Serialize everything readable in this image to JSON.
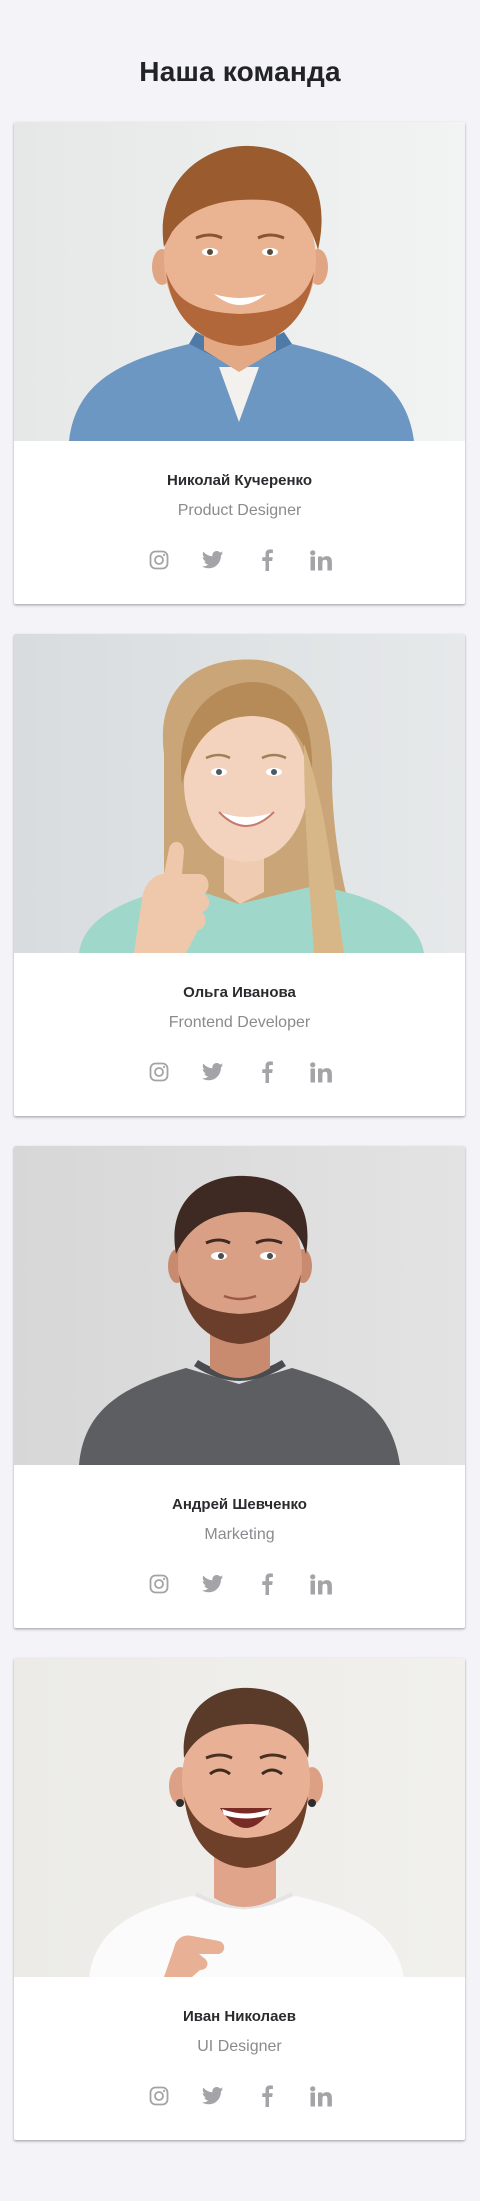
{
  "page": {
    "title": "Наша команда"
  },
  "colors": {
    "background": "#f4f3f8",
    "card": "#ffffff",
    "title": "#222327",
    "role": "#8a8a8f",
    "icon": "#a3a3a8"
  },
  "team": [
    {
      "name": "Николай Кучеренко",
      "role": "Product Designer",
      "photo": "man with light ginger hair and beard in denim shirt",
      "socials": [
        "instagram-icon",
        "twitter-icon",
        "facebook-icon",
        "linkedin-icon"
      ]
    },
    {
      "name": "Ольга Иванова",
      "role": "Frontend Developer",
      "photo": "smiling blonde woman showing thumbs up in mint sweater",
      "socials": [
        "instagram-icon",
        "twitter-icon",
        "facebook-icon",
        "linkedin-icon"
      ]
    },
    {
      "name": "Андрей Шевченко",
      "role": "Marketing",
      "photo": "man with dark hair and beard in gray t-shirt",
      "socials": [
        "instagram-icon",
        "twitter-icon",
        "facebook-icon",
        "linkedin-icon"
      ]
    },
    {
      "name": "Иван Николаев",
      "role": "UI Designer",
      "photo": "laughing man with beard in white t-shirt",
      "socials": [
        "instagram-icon",
        "twitter-icon",
        "facebook-icon",
        "linkedin-icon"
      ]
    }
  ]
}
